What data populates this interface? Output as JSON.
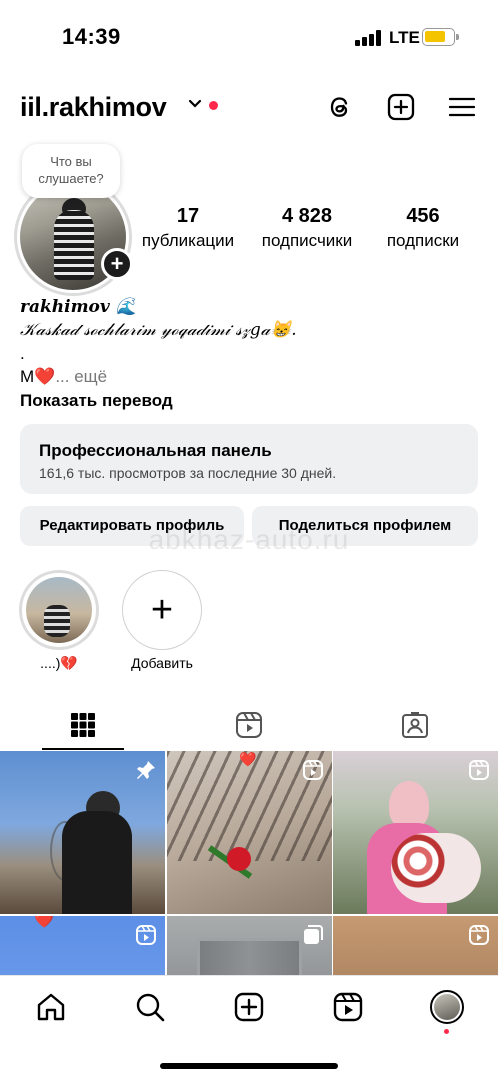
{
  "status_bar": {
    "time": "14:39",
    "network": "LTE",
    "battery_color": "#f5c400"
  },
  "header": {
    "username": "iil.rakhimov",
    "notification_color": "#ff2a4b"
  },
  "profile": {
    "note_bubble": "Что вы слушаете?",
    "stats": [
      {
        "value": "17",
        "label": "публикации"
      },
      {
        "value": "4 828",
        "label": "подписчики"
      },
      {
        "value": "456",
        "label": "подписки"
      }
    ],
    "bio": {
      "name": "𝒓𝒂𝒌𝒉𝒊𝒎𝒐𝒗 🌊",
      "line1": "𝒦𝒶𝓈𝓀𝒶𝒹 𝓈ℴ𝒸𝒽𝓁𝒶𝓇𝒾𝓂 𝓎ℴ𝓆𝒶𝒹𝒾𝓂𝒾 𝓈𝓏𝑔𝒶😸.",
      "line2": ".",
      "line3": "М❤️",
      "more": "... ещё",
      "translate": "Показать перевод"
    }
  },
  "pro_panel": {
    "title": "Профессиональная панель",
    "subtitle": "161,6 тыс. просмотров за последние 30 дней."
  },
  "buttons": {
    "edit_profile": "Редактировать профиль",
    "share_profile": "Поделиться профилем"
  },
  "watermark": "abkhaz-auto.ru",
  "highlights": [
    {
      "caption": "....)💔"
    },
    {
      "caption": "Добавить"
    }
  ],
  "tabs": [
    {
      "icon": "grid-icon",
      "active": true
    },
    {
      "icon": "reels-icon",
      "active": false
    },
    {
      "icon": "tagged-icon",
      "active": false
    }
  ],
  "grid": {
    "posts": [
      {
        "overlay": "pin-icon"
      },
      {
        "overlay": "reel-icon",
        "badge": "❤️"
      },
      {
        "overlay": "reel-icon"
      },
      {
        "overlay": "reel-icon",
        "badge": "❤️"
      },
      {
        "overlay": "carousel-icon"
      },
      {
        "overlay": "reel-icon"
      }
    ]
  },
  "bottom_nav": [
    "home-icon",
    "search-icon",
    "create-icon",
    "reels-icon",
    "profile-avatar"
  ]
}
